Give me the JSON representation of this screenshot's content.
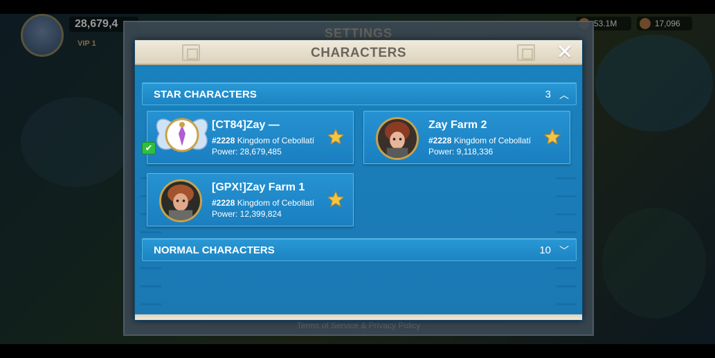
{
  "hud": {
    "power": "28,679,4",
    "vip": "VIP 1",
    "resource_1": "53.1M",
    "resource_2": "17,096"
  },
  "settings": {
    "title": "SETTINGS",
    "footer": "Terms of Service & Privacy Policy"
  },
  "modal": {
    "title": "CHARACTERS",
    "close_label": "✕"
  },
  "star_section": {
    "label": "STAR CHARACTERS",
    "count": "3",
    "chevron": "︿",
    "characters": [
      {
        "name": "[CT84]Zay —",
        "kingdom_id": "#2228",
        "kingdom_name": "Kingdom of Cebollatí",
        "power": "Power: 28,679,485",
        "current": true
      },
      {
        "name": "Zay Farm 2",
        "kingdom_id": "#2228",
        "kingdom_name": "Kingdom of Cebollatí",
        "power": "Power: 9,118,336",
        "current": false
      },
      {
        "name": "[GPX!]Zay Farm 1",
        "kingdom_id": "#2228",
        "kingdom_name": "Kingdom of Cebollatí",
        "power": "Power: 12,399,824",
        "current": false
      }
    ]
  },
  "normal_section": {
    "label": "NORMAL CHARACTERS",
    "count": "10",
    "chevron": "﹀"
  },
  "icons": {
    "star": "star-icon",
    "close": "close-icon",
    "check": "check-icon",
    "chevron_up": "chevron-up-icon",
    "chevron_down": "chevron-down-icon"
  },
  "colors": {
    "modal_bg": "#1b7ab5",
    "card_bg": "#2692d1",
    "star": "#f5c542",
    "header_bg": "#f1eadb"
  }
}
